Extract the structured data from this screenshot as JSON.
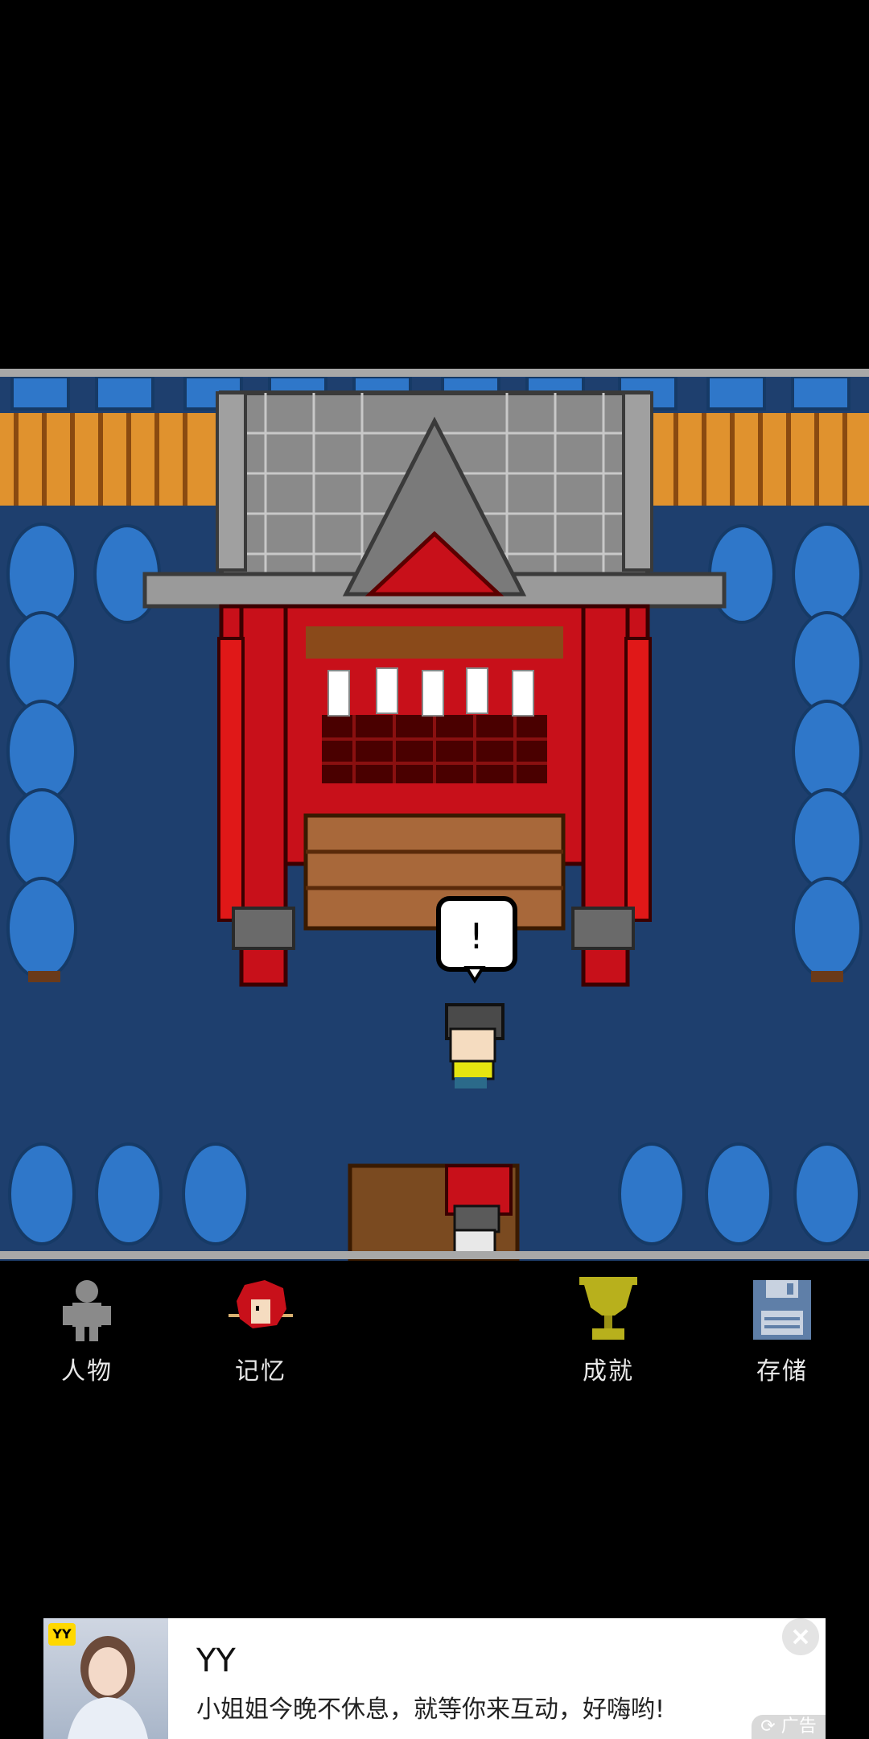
{
  "game": {
    "speech_bubble": "!"
  },
  "nav": {
    "items": [
      {
        "label": "人物",
        "icon": "character-icon"
      },
      {
        "label": "记忆",
        "icon": "memory-icon"
      },
      {
        "label": "成就",
        "icon": "trophy-icon"
      },
      {
        "label": "存储",
        "icon": "save-icon"
      }
    ]
  },
  "ad": {
    "badge": "YY",
    "title": "YY",
    "text": "小姐姐今晚不休息，就等你来互动，好嗨哟!",
    "tag": "广告"
  },
  "colors": {
    "ground": "#1e3f6e",
    "shrine_red": "#c8101a",
    "roof_gray": "#8a8a8a",
    "fence_orange": "#e0922e",
    "tree_blue": "#2f77c9",
    "trophy_gold": "#b8b01c",
    "save_blue": "#5f7fa8"
  }
}
